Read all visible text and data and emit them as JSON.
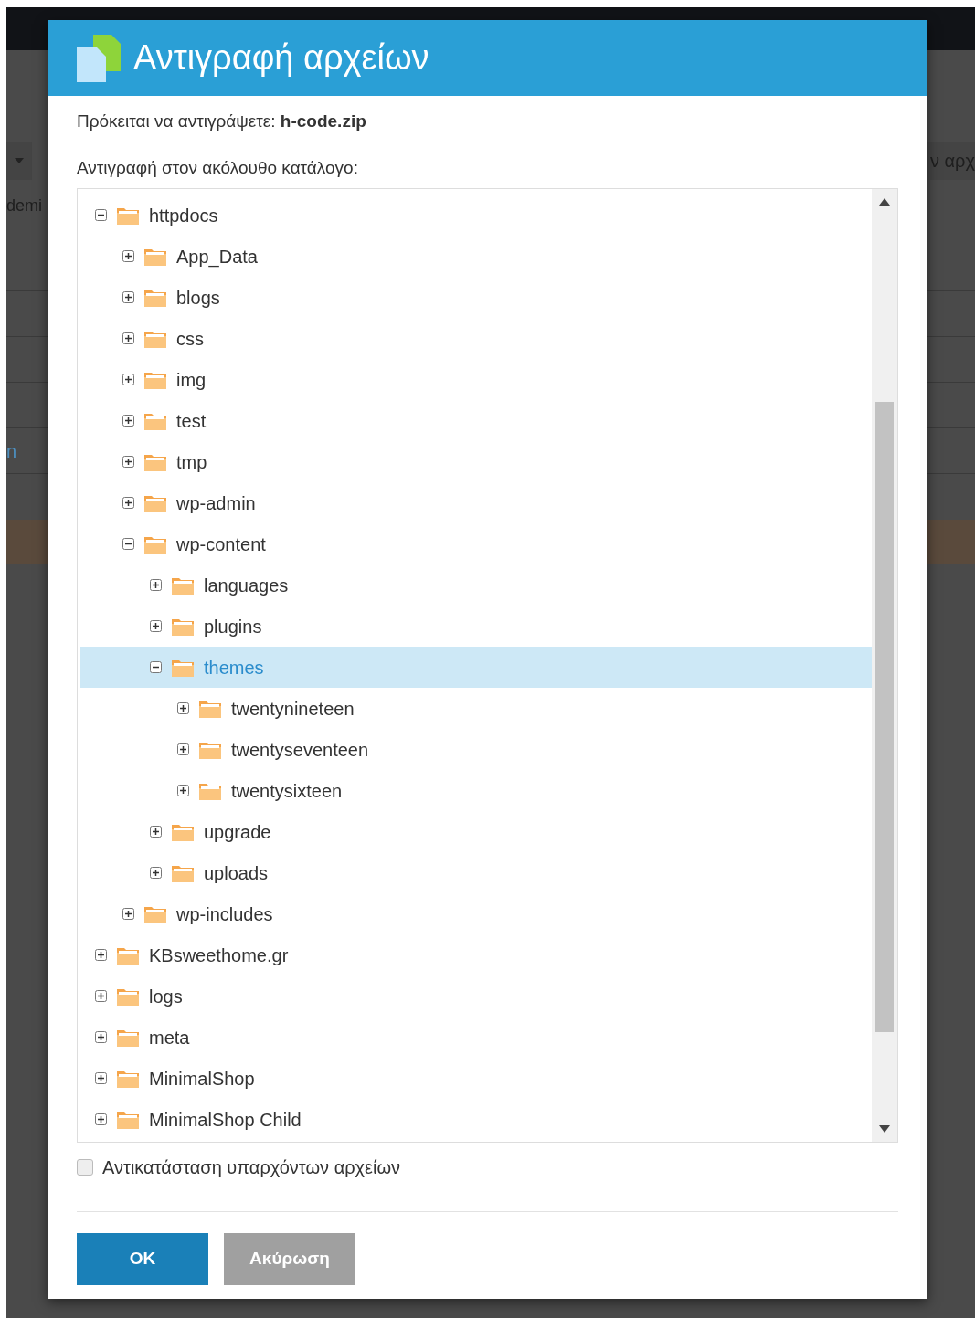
{
  "background": {
    "texts": [
      {
        "kind": "left",
        "text": "demi"
      },
      {
        "kind": "link",
        "text": "n"
      },
      {
        "kind": "right",
        "text": "ν αρχ"
      }
    ]
  },
  "dialog": {
    "title": "Αντιγραφή αρχείων",
    "intro": "Πρόκειται να αντιγράψετε: **h-code.zip**",
    "target_label": "Αντιγραφή στον ακόλουθο κατάλογο:",
    "tree": [
      {
        "label": "httpdocs",
        "expanded": true,
        "selected": false,
        "children": [
          {
            "label": "App_Data",
            "expanded": false,
            "selected": false
          },
          {
            "label": "blogs",
            "expanded": false,
            "selected": false
          },
          {
            "label": "css",
            "expanded": false,
            "selected": false
          },
          {
            "label": "img",
            "expanded": false,
            "selected": false
          },
          {
            "label": "test",
            "expanded": false,
            "selected": false
          },
          {
            "label": "tmp",
            "expanded": false,
            "selected": false
          },
          {
            "label": "wp-admin",
            "expanded": false,
            "selected": false
          },
          {
            "label": "wp-content",
            "expanded": true,
            "selected": false,
            "children": [
              {
                "label": "languages",
                "expanded": false,
                "selected": false
              },
              {
                "label": "plugins",
                "expanded": false,
                "selected": false
              },
              {
                "label": "themes",
                "expanded": true,
                "selected": true,
                "children": [
                  {
                    "label": "twentynineteen",
                    "expanded": false,
                    "selected": false
                  },
                  {
                    "label": "twentyseventeen",
                    "expanded": false,
                    "selected": false
                  },
                  {
                    "label": "twentysixteen",
                    "expanded": false,
                    "selected": false
                  }
                ]
              },
              {
                "label": "upgrade",
                "expanded": false,
                "selected": false
              },
              {
                "label": "uploads",
                "expanded": false,
                "selected": false
              }
            ]
          },
          {
            "label": "wp-includes",
            "expanded": false,
            "selected": false
          }
        ]
      },
      {
        "label": "KBsweethome.gr",
        "expanded": false,
        "selected": false
      },
      {
        "label": "logs",
        "expanded": false,
        "selected": false
      },
      {
        "label": "meta",
        "expanded": false,
        "selected": false
      },
      {
        "label": "MinimalShop",
        "expanded": false,
        "selected": false
      },
      {
        "label": "MinimalShop Child",
        "expanded": false,
        "selected": false
      }
    ],
    "overwrite": {
      "label": "Αντικατάσταση υπαρχόντων αρχείων",
      "checked": false
    },
    "buttons": [
      {
        "kind": "primary",
        "label": "OK"
      },
      {
        "kind": "secondary",
        "label": "Ακύρωση"
      }
    ]
  }
}
